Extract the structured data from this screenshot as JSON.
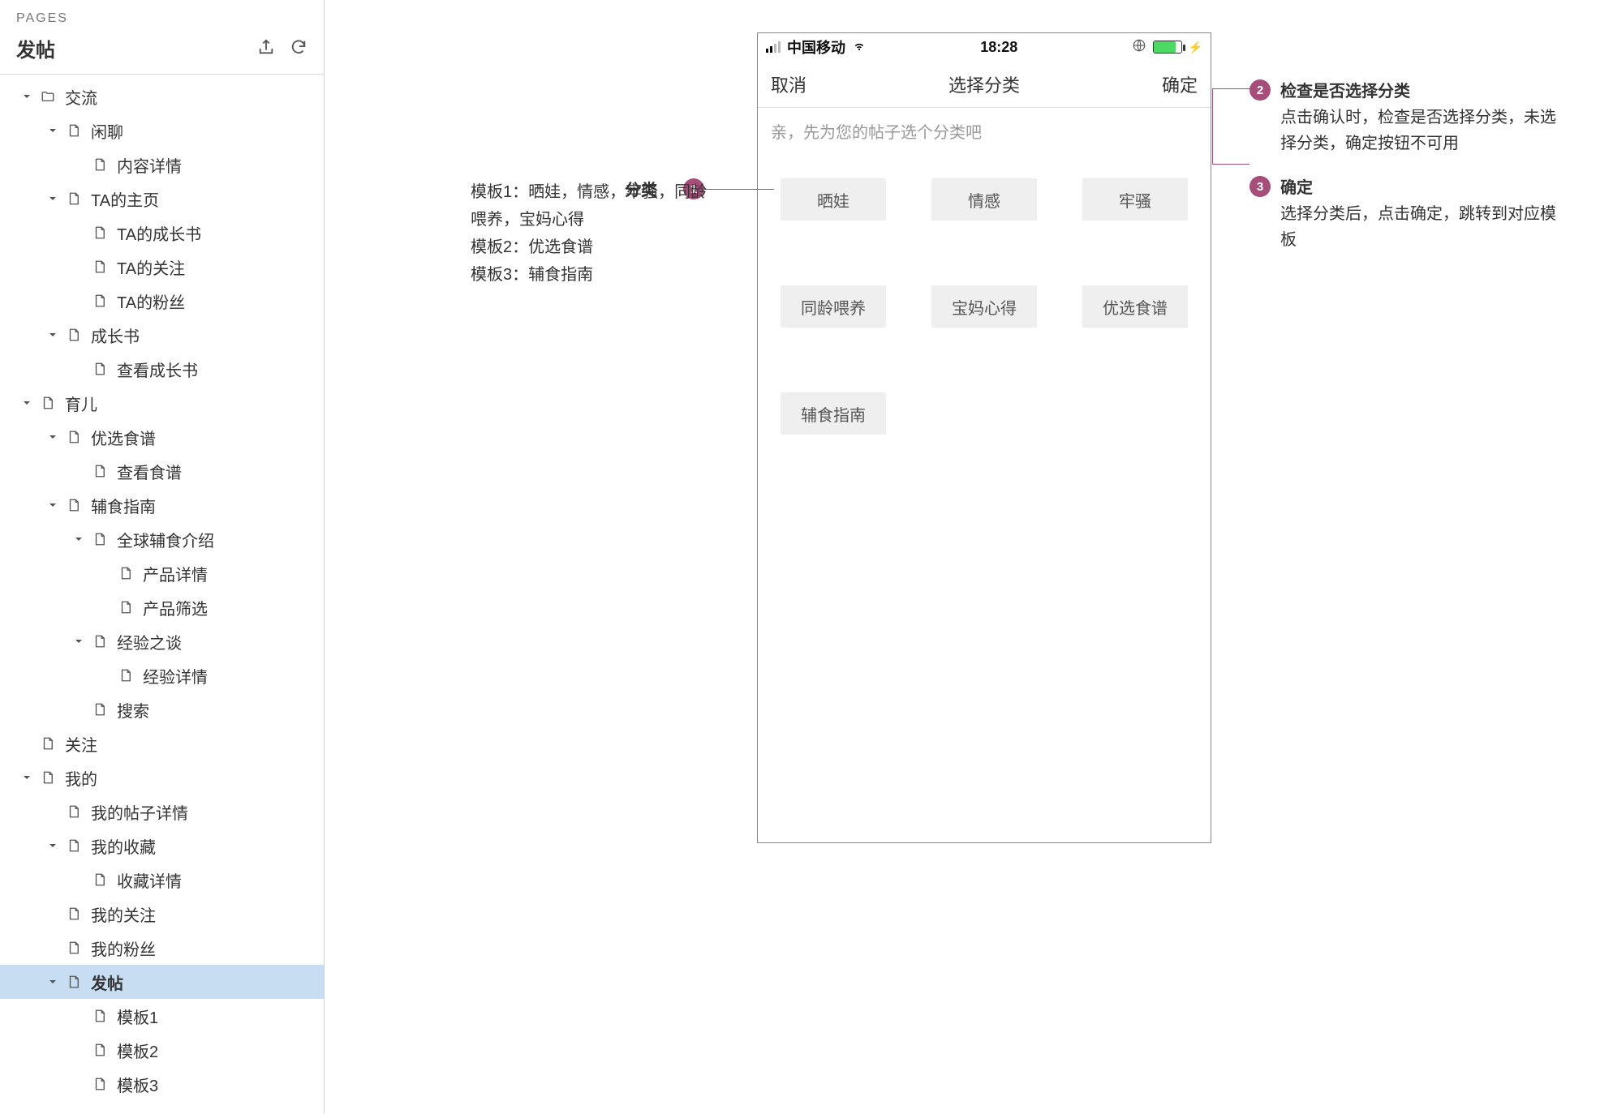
{
  "sidebar": {
    "header": "PAGES",
    "title": "发帖",
    "tree": [
      {
        "type": "folder",
        "label": "交流",
        "indent": 0
      },
      {
        "type": "page",
        "label": "闲聊",
        "indent": 1,
        "expandable": true
      },
      {
        "type": "page",
        "label": "内容详情",
        "indent": 2
      },
      {
        "type": "page",
        "label": "TA的主页",
        "indent": 1,
        "expandable": true
      },
      {
        "type": "page",
        "label": "TA的成长书",
        "indent": 2
      },
      {
        "type": "page",
        "label": "TA的关注",
        "indent": 2
      },
      {
        "type": "page",
        "label": "TA的粉丝",
        "indent": 2
      },
      {
        "type": "page",
        "label": "成长书",
        "indent": 1,
        "expandable": true
      },
      {
        "type": "page",
        "label": "查看成长书",
        "indent": 2
      },
      {
        "type": "page",
        "label": "育儿",
        "indent": 0,
        "expandable": true
      },
      {
        "type": "page",
        "label": "优选食谱",
        "indent": 1,
        "expandable": true
      },
      {
        "type": "page",
        "label": "查看食谱",
        "indent": 2
      },
      {
        "type": "page",
        "label": "辅食指南",
        "indent": 1,
        "expandable": true
      },
      {
        "type": "page",
        "label": "全球辅食介绍",
        "indent": 2,
        "expandable": true
      },
      {
        "type": "page",
        "label": "产品详情",
        "indent": 3
      },
      {
        "type": "page",
        "label": "产品筛选",
        "indent": 3
      },
      {
        "type": "page",
        "label": "经验之谈",
        "indent": 2,
        "expandable": true
      },
      {
        "type": "page",
        "label": "经验详情",
        "indent": 3
      },
      {
        "type": "page",
        "label": "搜索",
        "indent": 2
      },
      {
        "type": "page",
        "label": "关注",
        "indent": 0
      },
      {
        "type": "page",
        "label": "我的",
        "indent": 0,
        "expandable": true
      },
      {
        "type": "page",
        "label": "我的帖子详情",
        "indent": 1
      },
      {
        "type": "page",
        "label": "我的收藏",
        "indent": 1,
        "expandable": true
      },
      {
        "type": "page",
        "label": "收藏详情",
        "indent": 2
      },
      {
        "type": "page",
        "label": "我的关注",
        "indent": 1
      },
      {
        "type": "page",
        "label": "我的粉丝",
        "indent": 1
      },
      {
        "type": "page",
        "label": "发帖",
        "indent": 1,
        "expandable": true,
        "selected": true
      },
      {
        "type": "page",
        "label": "模板1",
        "indent": 2
      },
      {
        "type": "page",
        "label": "模板2",
        "indent": 2
      },
      {
        "type": "page",
        "label": "模板3",
        "indent": 2
      }
    ]
  },
  "mockup": {
    "status": {
      "carrier": "中国移动",
      "time": "18:28"
    },
    "nav": {
      "cancel": "取消",
      "title": "选择分类",
      "confirm": "确定"
    },
    "hint": "亲，先为您的帖子选个分类吧",
    "categories": [
      "晒娃",
      "情感",
      "牢骚",
      "同龄喂养",
      "宝妈心得",
      "优选食谱",
      "辅食指南"
    ]
  },
  "annotations": {
    "left": {
      "num": "1",
      "title": "分类",
      "lines": [
        "模板1：晒娃，情感，牢骚，同龄喂养，宝妈心得",
        "模板2：优选食谱",
        "模板3：辅食指南"
      ]
    },
    "right": [
      {
        "num": "2",
        "title": "检查是否选择分类",
        "desc": "点击确认时，检查是否选择分类，未选择分类，确定按钮不可用"
      },
      {
        "num": "3",
        "title": "确定",
        "desc": "选择分类后，点击确定，跳转到对应模板"
      }
    ]
  }
}
